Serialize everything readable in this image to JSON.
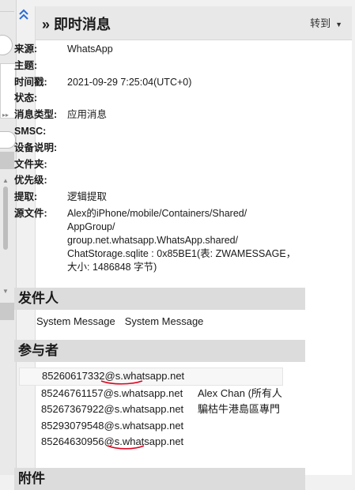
{
  "panel": {
    "title": "» 即时消息",
    "goto_label": "转到"
  },
  "properties": [
    {
      "label": "来源:",
      "value": "WhatsApp"
    },
    {
      "label": "主题:",
      "value": ""
    },
    {
      "label": "时间戳:",
      "value": "2021-09-29 7:25:04(UTC+0)"
    },
    {
      "label": "状态:",
      "value": ""
    },
    {
      "label": "消息类型:",
      "value": "应用消息"
    },
    {
      "label": "SMSC:",
      "value": ""
    },
    {
      "label": "设备说明:",
      "value": ""
    },
    {
      "label": "文件夹:",
      "value": ""
    },
    {
      "label": "优先级:",
      "value": ""
    },
    {
      "label": "提取:",
      "value": "逻辑提取"
    },
    {
      "label": "源文件:",
      "value": "Alex的iPhone/mobile/Containers/Shared/AppGroup/group.net.whatsapp.WhatsApp.shared/ChatStorage.sqlite : 0x85BE1(表: ZWAMESSAGE，大小: 1486848 字节)"
    }
  ],
  "source_file_lines": [
    "Alex的iPhone/mobile/Containers/Shared/",
    "AppGroup/",
    "group.net.whatsapp.WhatsApp.shared/",
    "ChatStorage.sqlite : 0x85BE1(表: ZWAMESSAGE，",
    "大小: 1486848 字节)"
  ],
  "sender": {
    "header": "发件人",
    "id": "System Message",
    "name": "System Message"
  },
  "participants": {
    "header": "参与者",
    "items": [
      {
        "jid": "85260617332@s.whatsapp.net",
        "name": ""
      },
      {
        "jid": "85246761157@s.whatsapp.net",
        "name": "Alex Chan (所有人"
      },
      {
        "jid": "85267367922@s.whatsapp.net",
        "name": "騙枯牛港島區專門"
      },
      {
        "jid": "85293079548@s.whatsapp.net",
        "name": ""
      },
      {
        "jid": "85264630956@s.whatsapp.net",
        "name": ""
      }
    ]
  },
  "attachments": {
    "header": "附件"
  },
  "colors": {
    "accent": "#2b6cd6",
    "annotation_red": "#e0001b",
    "header_bg": "#e8e8e8",
    "section_bg": "#dcdcdc"
  },
  "icons": {
    "collapse": "double-chevron-up-icon",
    "goto_caret": "caret-down-icon"
  }
}
